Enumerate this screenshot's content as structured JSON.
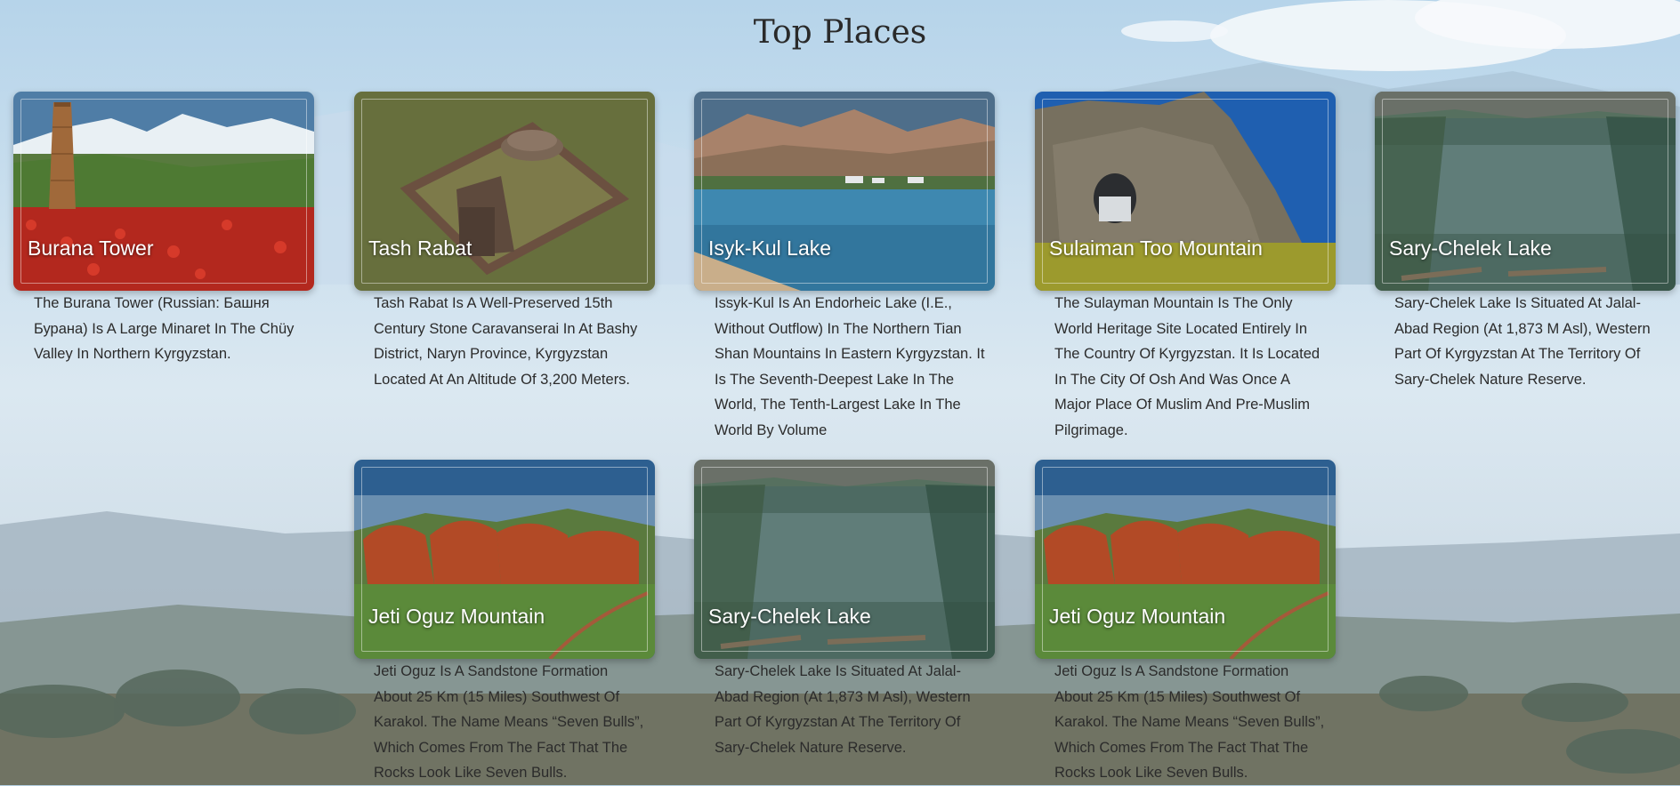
{
  "page": {
    "title": "Top Places"
  },
  "places": [
    {
      "name": "Burana Tower",
      "description": "The Burana Tower (Russian: Башня Бурана) Is A Large Minaret In The Chüy Valley In Northern Kyrgyzstan."
    },
    {
      "name": "Tash Rabat",
      "description": "Tash Rabat Is A Well-Preserved 15th Century Stone Caravanserai In At Bashy District, Naryn Province, Kyrgyzstan Located At An Altitude Of 3,200 Meters."
    },
    {
      "name": "Isyk-Kul Lake",
      "description": "Issyk-Kul Is An Endorheic Lake (I.E., Without Outflow) In The Northern Tian Shan Mountains In Eastern Kyrgyzstan. It Is The Seventh-Deepest Lake In The World, The Tenth-Largest Lake In The World By Volume"
    },
    {
      "name": "Sulaiman Too Mountain",
      "description": "The Sulayman Mountain Is The Only World Heritage Site Located Entirely In The Country Of Kyrgyzstan. It Is Located In The City Of Osh And Was Once A Major Place Of Muslim And Pre-Muslim Pilgrimage."
    },
    {
      "name": "Sary-Chelek Lake",
      "description": "Sary-Chelek Lake Is Situated At Jalal-Abad Region (At 1,873 M Asl), Western Part Of Kyrgyzstan At The Territory Of Sary-Chelek Nature Reserve."
    },
    {
      "name": "Jeti Oguz Mountain",
      "description": "Jeti Oguz Is A Sandstone Formation About 25 Km (15 Miles) Southwest Of Karakol. The Name Means “Seven Bulls”, Which Comes From The Fact That The Rocks Look Like Seven Bulls."
    },
    {
      "name": "Sary-Chelek Lake",
      "description": "Sary-Chelek Lake Is Situated At Jalal-Abad Region (At 1,873 M Asl), Western Part Of Kyrgyzstan At The Territory Of Sary-Chelek Nature Reserve."
    },
    {
      "name": "Jeti Oguz Mountain",
      "description": "Jeti Oguz Is A Sandstone Formation About 25 Km (15 Miles) Southwest Of Karakol. The Name Means “Seven Bulls”, Which Comes From The Fact That The Rocks Look Like Seven Bulls."
    }
  ]
}
